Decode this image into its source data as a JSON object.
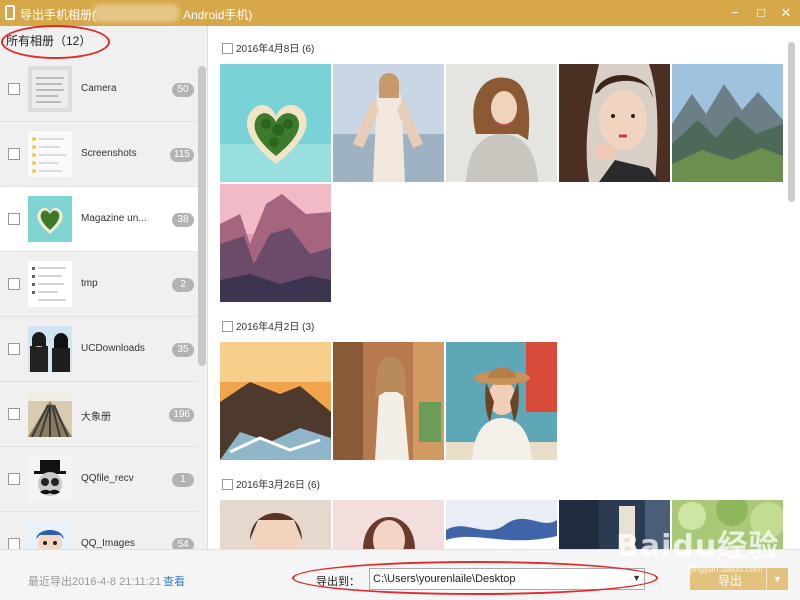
{
  "window": {
    "title_left": "导出手机相册(",
    "title_right": "Android手机)",
    "controls": {
      "minimize": "−",
      "maximize": "□",
      "close": "✕"
    }
  },
  "sidebar": {
    "header": "所有相册（12）",
    "items": [
      {
        "name": "Camera",
        "count": "50"
      },
      {
        "name": "Screenshots",
        "count": "115"
      },
      {
        "name": "Magazine un...",
        "count": "38"
      },
      {
        "name": "tmp",
        "count": "2"
      },
      {
        "name": "UCDownloads",
        "count": "35"
      },
      {
        "name": "大象册",
        "count": "196"
      },
      {
        "name": "QQfile_recv",
        "count": "1"
      },
      {
        "name": "QQ_Images",
        "count": "54"
      }
    ]
  },
  "main": {
    "groups": [
      {
        "date": "2016年4月8日 (6)",
        "photos": 6
      },
      {
        "date": "2016年4月2日 (3)",
        "photos": 3
      },
      {
        "date": "2016年3月26日 (6)",
        "photos": 5
      }
    ]
  },
  "footer": {
    "recent_label": "最近导出2016-4-8 21:11:21",
    "view_link": "查看",
    "export_to_label": "导出到：",
    "path": "C:\\Users\\yourenlaile\\Desktop",
    "export_button": "导出"
  },
  "watermark": {
    "text": "Baidu经验",
    "sub": "jingyan.baidu.com"
  },
  "colors": {
    "titlebar": "#d6a84a",
    "export_button": "#e3c27f",
    "annotation": "#e32a2a",
    "link": "#2e7fd6"
  }
}
